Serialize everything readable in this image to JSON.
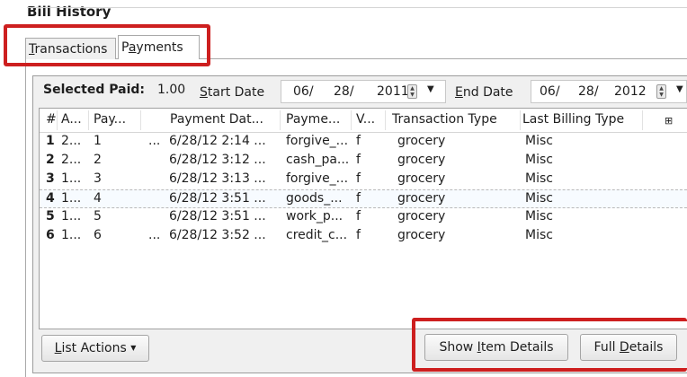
{
  "window": {
    "title": "Bill History"
  },
  "tabs": [
    {
      "label": "Transactions",
      "selected": false
    },
    {
      "label": "Payments",
      "selected": true
    }
  ],
  "filter": {
    "selected_paid_label": "Selected Paid:",
    "selected_paid_value": "1.00",
    "start_date_label": "Start Date",
    "start_date": {
      "month": "06/",
      "day": "28/",
      "year": "2011"
    },
    "end_date_label": "End Date",
    "end_date": {
      "month": "06/",
      "day": "28/",
      "year": "2012"
    }
  },
  "grid": {
    "columns": [
      "#",
      "A...",
      "Pay...",
      "Payment Dat...",
      "Payme...",
      "V...",
      "Transaction Type",
      "Last Billing Type"
    ],
    "column_chooser_icon": "column-chooser-icon",
    "selected_row_index": 3,
    "rows": [
      {
        "num": "1",
        "a": "2...",
        "pay": "1",
        "prefix": "...",
        "date": "6/28/12 2:14 ...",
        "payme": "forgive_...",
        "v": "f",
        "ttype": "grocery",
        "lbt": "Misc"
      },
      {
        "num": "2",
        "a": "2...",
        "pay": "2",
        "prefix": "",
        "date": "6/28/12 3:12 ...",
        "payme": "cash_pa...",
        "v": "f",
        "ttype": "grocery",
        "lbt": "Misc"
      },
      {
        "num": "3",
        "a": "1...",
        "pay": "3",
        "prefix": "",
        "date": "6/28/12 3:13 ...",
        "payme": "forgive_...",
        "v": "f",
        "ttype": "grocery",
        "lbt": "Misc"
      },
      {
        "num": "4",
        "a": "1...",
        "pay": "4",
        "prefix": "",
        "date": "6/28/12 3:51 ...",
        "payme": "goods_...",
        "v": "f",
        "ttype": "grocery",
        "lbt": "Misc"
      },
      {
        "num": "5",
        "a": "1...",
        "pay": "5",
        "prefix": "",
        "date": "6/28/12 3:51 ...",
        "payme": "work_p...",
        "v": "f",
        "ttype": "grocery",
        "lbt": "Misc"
      },
      {
        "num": "6",
        "a": "1...",
        "pay": "6",
        "prefix": "...",
        "date": "6/28/12 3:52 ...",
        "payme": "credit_c...",
        "v": "f",
        "ttype": "grocery",
        "lbt": "Misc"
      }
    ]
  },
  "buttons": {
    "list_actions": "List Actions",
    "show_item_details": "Show Item Details",
    "full_details": "Full Details"
  },
  "annotation_color": "#cd1f1f"
}
